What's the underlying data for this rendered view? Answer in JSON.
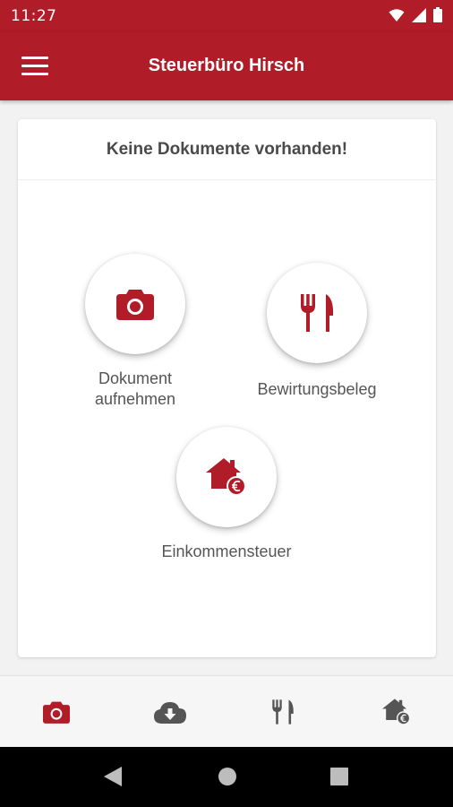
{
  "status_bar": {
    "time": "11:27"
  },
  "app_bar": {
    "title": "Steuerbüro Hirsch"
  },
  "card": {
    "title": "Keine Dokumente vorhanden!"
  },
  "actions": [
    {
      "label_line1": "Dokument",
      "label_line2": "aufnehmen",
      "icon": "camera-icon"
    },
    {
      "label": "Bewirtungsbeleg",
      "icon": "fork-knife-icon"
    },
    {
      "label": "Einkommensteuer",
      "icon": "house-euro-icon"
    }
  ],
  "bottom_nav": [
    {
      "icon": "camera-icon",
      "active": true
    },
    {
      "icon": "cloud-download-icon",
      "active": false
    },
    {
      "icon": "fork-knife-icon",
      "active": false
    },
    {
      "icon": "house-euro-icon",
      "active": false
    }
  ],
  "colors": {
    "brand": "#b01c27",
    "inactive_icon": "#555555",
    "label": "#555555"
  }
}
